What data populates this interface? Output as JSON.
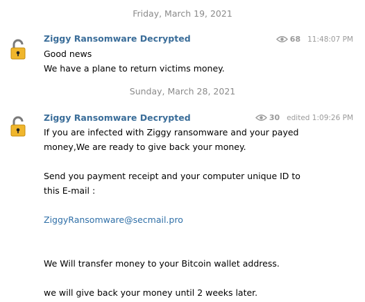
{
  "colors": {
    "sender": "#3a6d99",
    "link": "#2f6fa7",
    "meta": "#9a9a9a",
    "date": "#8a8a8a",
    "lock_body": "#f0b62c"
  },
  "messages": [
    {
      "date": "Friday, March 19, 2021",
      "sender": "Ziggy Ransomware Decrypted",
      "views": "68",
      "time": "11:48:07 PM",
      "avatar_icon": "padlock-icon",
      "lines": [
        "Good news",
        "We have a plane to return victims money."
      ]
    },
    {
      "date": "Sunday, March 28, 2021",
      "sender": "Ziggy Ransomware Decrypted",
      "views": "30",
      "time": "edited 1:09:26 PM",
      "avatar_icon": "padlock-icon",
      "lines": [
        "If you are infected with Ziggy ransomware and your payed",
        "money,We are ready to give back your money.",
        "Send you payment receipt and your computer  unique ID to",
        "this E-mail :",
        "ZiggyRansomware@secmail.pro",
        "We Will transfer money to your Bitcoin wallet address.",
        "we will give back your money until 2 weeks later."
      ]
    }
  ]
}
